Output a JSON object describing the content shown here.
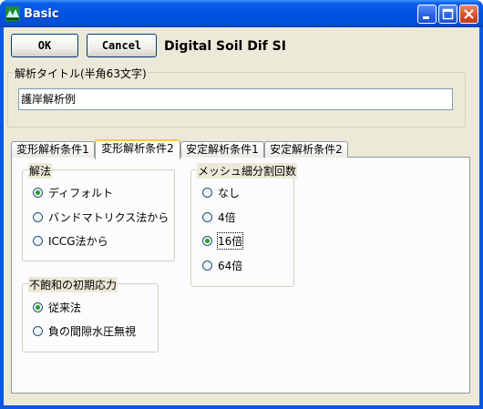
{
  "window": {
    "title": "Basic",
    "icon": "app-icon",
    "controls": [
      "minimize-icon",
      "maximize-icon",
      "close-icon"
    ]
  },
  "toolbar": {
    "ok_label": "OK",
    "cancel_label": "Cancel",
    "app_heading": "Digital Soil Dif SI"
  },
  "analysis_title": {
    "label": "解析タイトル(半角63文字)",
    "value": "護岸解析例"
  },
  "tabs": [
    {
      "label": "変形解析条件1",
      "active": false
    },
    {
      "label": "変形解析条件2",
      "active": true
    },
    {
      "label": "安定解析条件1",
      "active": false
    },
    {
      "label": "安定解析条件2",
      "active": false
    }
  ],
  "method_group": {
    "label": "解法",
    "options": [
      "ディフォルト",
      "バンドマトリクス法から",
      "ICCG法から"
    ],
    "selected": "ディフォルト"
  },
  "initial_stress_group": {
    "label": "不飽和の初期応力",
    "options": [
      "従来法",
      "負の間隙水圧無視"
    ],
    "selected": "従来法"
  },
  "mesh_group": {
    "label": "メッシュ細分割回数",
    "options": [
      "なし",
      "4倍",
      "16倍",
      "64倍"
    ],
    "selected": "16倍"
  },
  "colors": {
    "titlebar": "#0054e3",
    "face": "#ece9d8",
    "tab_highlight": "#ffc83c",
    "radio_dot": "#21a121"
  }
}
